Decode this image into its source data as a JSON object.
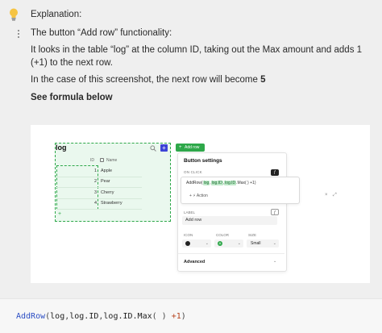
{
  "callout": {
    "icon": "lightbulb-icon",
    "heading": "Explanation:",
    "line1": "The button “Add row” functionality:",
    "line2": "It looks in the table “log” at the column ID, taking out the Max amount and adds 1 (+1) to the next row.",
    "line3_prefix": "In the case of this screenshot, the next row will become ",
    "line3_value": "5",
    "line4": "See formula below"
  },
  "screenshot": {
    "table": {
      "title": "log",
      "add_label": "+",
      "columns": [
        "ID",
        "Name"
      ],
      "rows": [
        {
          "id": "1",
          "name": "Apple"
        },
        {
          "id": "2",
          "name": "Pear"
        },
        {
          "id": "3",
          "name": "Cherry"
        },
        {
          "id": "4",
          "name": "Strawberry"
        }
      ],
      "add_row_plus": "+"
    },
    "add_row_pill": {
      "plus": "+",
      "label": "Add row"
    },
    "panel": {
      "title": "Button settings",
      "on_click_label": "ON CLICK",
      "fx_label": "ƒ",
      "formula": {
        "fn": "AddRow(",
        "tok1": "log",
        "sep1": ",",
        "tok2": "log.ID",
        "sep2": ",",
        "tok3": "log.ID",
        "tail": ".Max( ) +1)"
      },
      "action_label": "+ ⚡ Action",
      "label_label": "LABEL",
      "label_value": "Add row",
      "icon_label": "ICON",
      "color_label": "COLOR",
      "size_label": "SIZE",
      "size_value": "Small",
      "advanced_label": "Advanced",
      "chevron": "⌄"
    },
    "colors": {
      "accent_green": "#2ea84a",
      "add_button_blue": "#3c43d6"
    }
  },
  "code": {
    "fn": "AddRow",
    "open": "(",
    "a1": "log",
    "c1": ",",
    "a2": "log.ID",
    "c2": ",",
    "a3": "log.ID.Max",
    "paren": "( ) ",
    "num": "+1",
    "close": ")"
  }
}
